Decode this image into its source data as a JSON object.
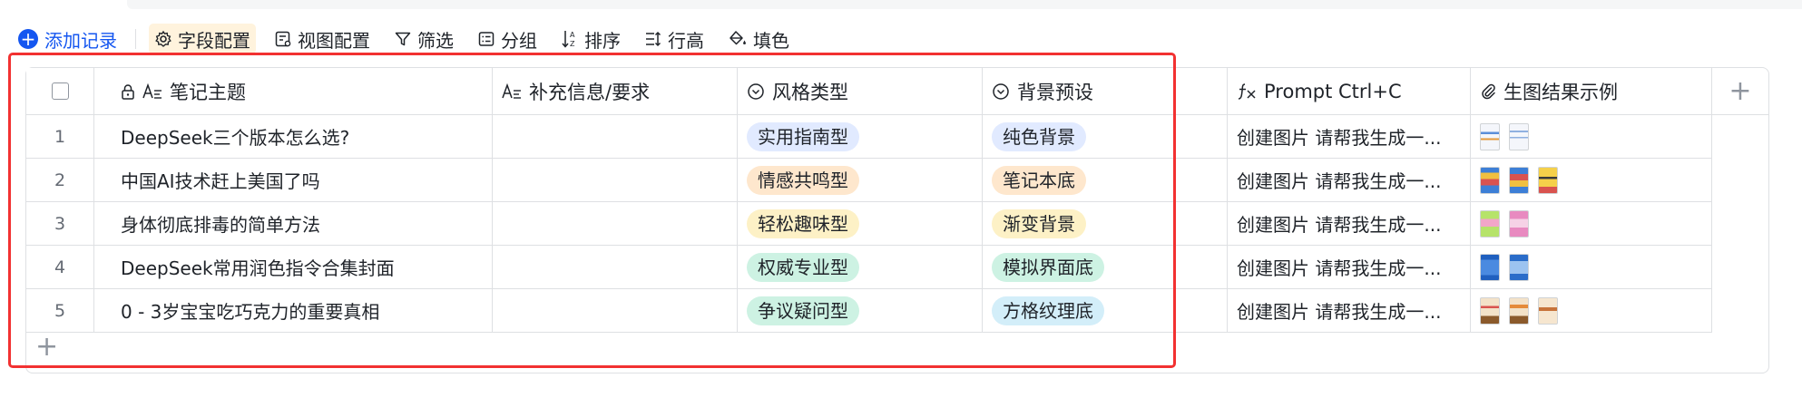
{
  "toolbar": {
    "add_record": "添加记录",
    "buttons": [
      {
        "label": "字段配置",
        "icon": "gear-icon",
        "active": true
      },
      {
        "label": "视图配置",
        "icon": "view-settings-icon",
        "active": false
      },
      {
        "label": "筛选",
        "icon": "filter-icon",
        "active": false
      },
      {
        "label": "分组",
        "icon": "group-icon",
        "active": false
      },
      {
        "label": "排序",
        "icon": "sort-icon",
        "active": false
      },
      {
        "label": "行高",
        "icon": "row-height-icon",
        "active": false
      },
      {
        "label": "填色",
        "icon": "paint-bucket-icon",
        "active": false
      }
    ]
  },
  "table": {
    "columns": [
      {
        "label": "笔记主题",
        "icons": [
          "lock-icon",
          "text-field-icon"
        ]
      },
      {
        "label": "补充信息/要求",
        "icons": [
          "text-field-icon"
        ]
      },
      {
        "label": "风格类型",
        "icons": [
          "single-select-icon"
        ]
      },
      {
        "label": "背景预设",
        "icons": [
          "single-select-icon"
        ]
      },
      {
        "label": "Prompt Ctrl+C",
        "icons": [
          "formula-icon"
        ]
      },
      {
        "label": "生图结果示例",
        "icons": [
          "attachment-icon"
        ]
      }
    ],
    "rows": [
      {
        "num": "1",
        "topic": "DeepSeek三个版本怎么选?",
        "extra": "",
        "style": "实用指南型",
        "bg": "纯色背景",
        "prompt": "创建图片 请帮我生成一...",
        "images": 2
      },
      {
        "num": "2",
        "topic": "中国AI技术赶上美国了吗",
        "extra": "",
        "style": "情感共鸣型",
        "bg": "笔记本底",
        "prompt": "创建图片 请帮我生成一...",
        "images": 3
      },
      {
        "num": "3",
        "topic": "身体彻底排毒的简单方法",
        "extra": "",
        "style": "轻松趣味型",
        "bg": "渐变背景",
        "prompt": "创建图片 请帮我生成一...",
        "images": 2
      },
      {
        "num": "4",
        "topic": "DeepSeek常用润色指令合集封面",
        "extra": "",
        "style": "权威专业型",
        "bg": "模拟界面底",
        "prompt": "创建图片 请帮我生成一...",
        "images": 2
      },
      {
        "num": "5",
        "topic": "0 - 3岁宝宝吃巧克力的重要真相",
        "extra": "",
        "style": "争议疑问型",
        "bg": "方格纹理底",
        "prompt": "创建图片 请帮我生成一...",
        "images": 3
      }
    ]
  },
  "colors": {
    "accent": "#1456f0",
    "highlight_box": "#f23131",
    "tag_blue": "#e1eaff",
    "tag_orange": "#fee7cd",
    "tag_yellow": "#fdf1c6",
    "tag_green": "#cdf2e3",
    "tag_cyan": "#d3eef9"
  }
}
